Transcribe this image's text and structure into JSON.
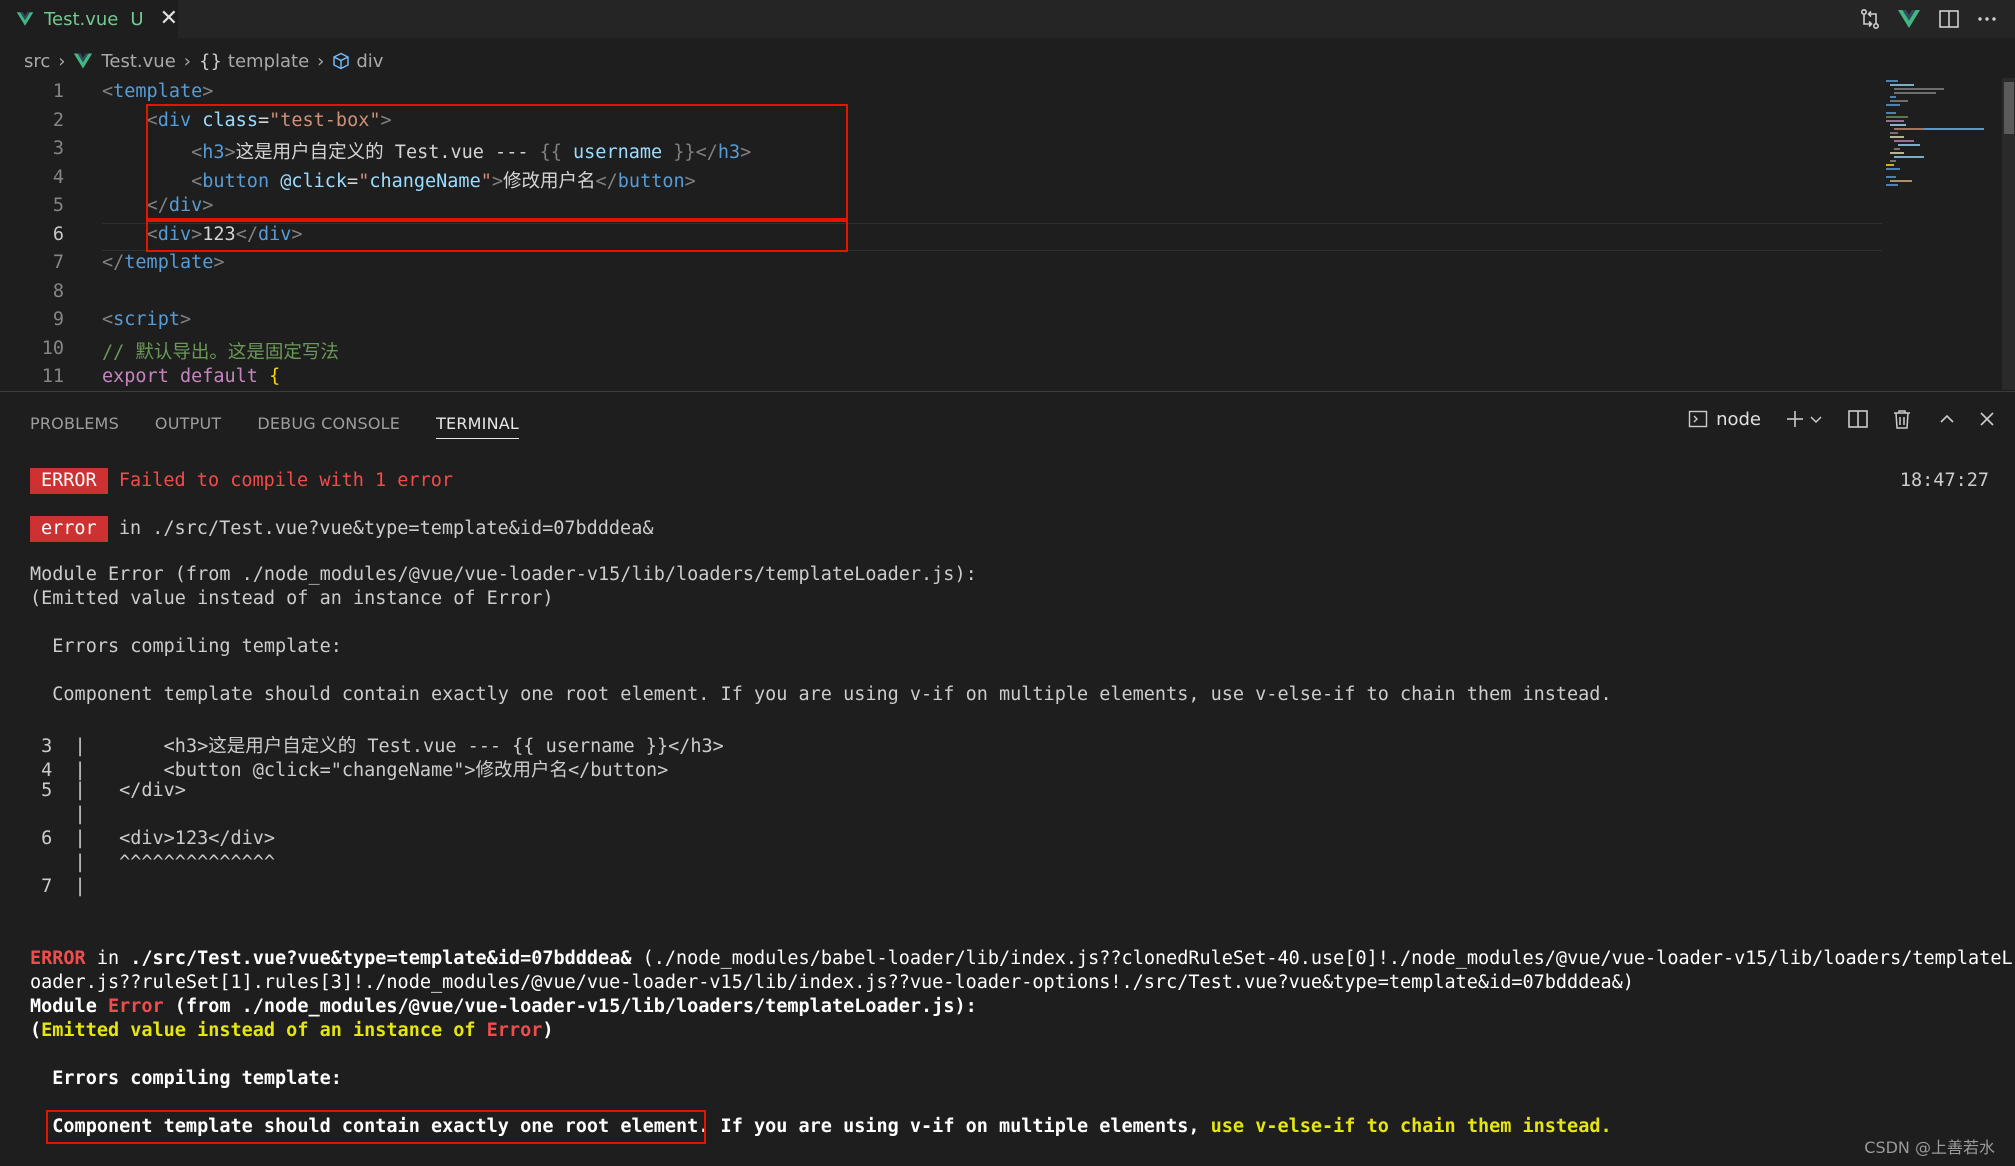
{
  "tab": {
    "filename": "Test.vue",
    "status": "U",
    "close": "✕"
  },
  "title_icons": [
    "compare-changes-icon",
    "vue-devtools-icon",
    "split-editor-icon",
    "more-actions-icon"
  ],
  "breadcrumb": {
    "root": "src",
    "file": "Test.vue",
    "section": "template",
    "element": "div"
  },
  "editor": {
    "line_numbers": [
      "1",
      "2",
      "3",
      "4",
      "5",
      "6",
      "7",
      "8",
      "9",
      "10",
      "11"
    ],
    "current_line": "6",
    "lines": [
      [
        [
          "tg",
          "<"
        ],
        [
          "tn",
          "template"
        ],
        [
          "tg",
          ">"
        ]
      ],
      [
        [
          "tg",
          "    <"
        ],
        [
          "tn",
          "div"
        ],
        [
          "tx",
          " "
        ],
        [
          "at",
          "class"
        ],
        [
          "tx",
          "="
        ],
        [
          "st",
          "\"test-box\""
        ],
        [
          "tg",
          ">"
        ]
      ],
      [
        [
          "tg",
          "        <"
        ],
        [
          "tn",
          "h3"
        ],
        [
          "tg",
          ">"
        ],
        [
          "tx",
          "这是用户自定义的 Test.vue --- "
        ],
        [
          "tg",
          "{{ "
        ],
        [
          "at",
          "username"
        ],
        [
          "tg",
          " }}"
        ],
        [
          "tg",
          "</"
        ],
        [
          "tn",
          "h3"
        ],
        [
          "tg",
          ">"
        ]
      ],
      [
        [
          "tg",
          "        <"
        ],
        [
          "tn",
          "button"
        ],
        [
          "tx",
          " "
        ],
        [
          "at",
          "@click"
        ],
        [
          "tx",
          "="
        ],
        [
          "st",
          "\""
        ],
        [
          "at",
          "changeName"
        ],
        [
          "st",
          "\""
        ],
        [
          "tg",
          ">"
        ],
        [
          "tx",
          "修改用户名"
        ],
        [
          "tg",
          "</"
        ],
        [
          "tn",
          "button"
        ],
        [
          "tg",
          ">"
        ]
      ],
      [
        [
          "tg",
          "    </"
        ],
        [
          "tn",
          "div"
        ],
        [
          "tg",
          ">"
        ]
      ],
      [
        [
          "tg",
          "    <"
        ],
        [
          "tn",
          "div"
        ],
        [
          "tg",
          ">"
        ],
        [
          "tx",
          "123"
        ],
        [
          "tg",
          "</"
        ],
        [
          "tn",
          "div"
        ],
        [
          "tg",
          ">"
        ]
      ],
      [
        [
          "tg",
          "</"
        ],
        [
          "tn",
          "template"
        ],
        [
          "tg",
          ">"
        ]
      ],
      [],
      [
        [
          "tg",
          "<"
        ],
        [
          "tn",
          "script"
        ],
        [
          "tg",
          ">"
        ]
      ],
      [
        [
          "cm",
          "// 默认导出。这是固定写法"
        ]
      ],
      [
        [
          "kw",
          "export"
        ],
        [
          "tx",
          " "
        ],
        [
          "kw",
          "default"
        ],
        [
          "tx",
          " "
        ],
        [
          "br",
          "{"
        ]
      ]
    ]
  },
  "panel": {
    "tabs": [
      "PROBLEMS",
      "OUTPUT",
      "DEBUG CONSOLE",
      "TERMINAL"
    ],
    "active_tab": "TERMINAL",
    "terminal_name": "node"
  },
  "terminal": {
    "badge1": "ERROR",
    "msg1": "Failed to compile with 1 error",
    "timestamp": "18:47:27",
    "badge2": "error",
    "msg2": "in ./src/Test.vue?vue&type=template&id=07bdddea&",
    "module_error": "Module Error (from ./node_modules/@vue/vue-loader-v15/lib/loaders/templateLoader.js):",
    "emitted": "(Emitted value instead of an instance of Error)",
    "errors_compiling": "  Errors compiling template:",
    "component_msg": "  Component template should contain exactly one root element. If you are using v-if on multiple elements, use v-else-if to chain them instead.",
    "snippet": [
      {
        "n": "3",
        "t": "      <h3>这是用户自定义的 Test.vue --- {{ username }}</h3>"
      },
      {
        "n": "4",
        "t": "      <button @click=\"changeName\">修改用户名</button>"
      },
      {
        "n": "5",
        "t": "  </div>"
      },
      {
        "n": "",
        "t": ""
      },
      {
        "n": "6",
        "t": "  <div>123</div>"
      },
      {
        "n": "",
        "t": "  ^^^^^^^^^^^^^^"
      },
      {
        "n": "7",
        "t": ""
      }
    ],
    "err2_word": "ERROR",
    "err2_in": " in ",
    "err2_path": "./src/Test.vue?vue&type=template&id=07bdddea&",
    "err2_rest1": " (./node_modules/babel-loader/lib/index.js??clonedRuleSet-40.use[0]!./node_modules/@vue/vue-loader-v15/lib/loaders/templateL",
    "err2_rest2": "oader.js??ruleSet[1].rules[3]!./node_modules/@vue/vue-loader-v15/lib/index.js??vue-loader-options!./src/Test.vue?vue&type=template&id=07bdddea&)",
    "mod2_a": "Module ",
    "mod2_err": "Error",
    "mod2_b": " (from ./node_modules/@vue/vue-loader-v15/lib/loaders/templateLoader.js):",
    "emit2_a": "(",
    "emit2_mid": "Emitted value instead of an instance of ",
    "emit2_err": "Error",
    "emit2_b": ")",
    "errors_compiling2": "  Errors compiling template:",
    "boxed": "Component template should contain exactly one root element.",
    "comp2_mid": " If you are using v-if on multiple elements, ",
    "comp2_yel": "use v-else-if to chain them instead."
  },
  "watermark": "CSDN @上善若水"
}
